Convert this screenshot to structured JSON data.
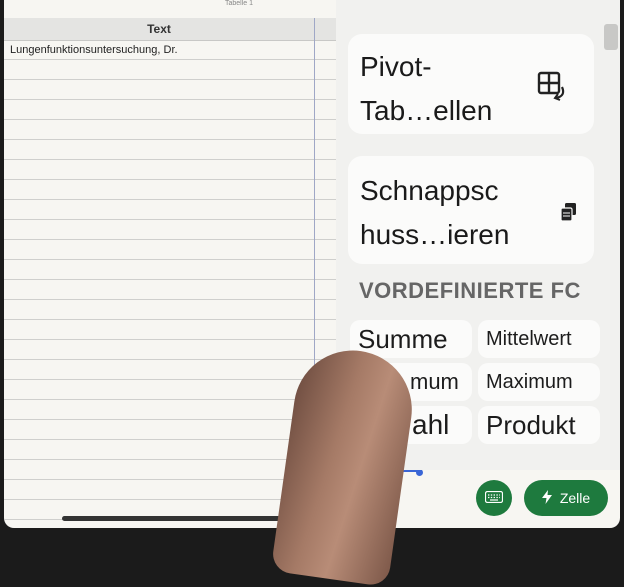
{
  "sheet": {
    "tab_name": "Tabelle 1",
    "column_header": "Text",
    "cell_a1": "Lungenfunktionsuntersuchung, Dr."
  },
  "panel": {
    "pivot_label_line1": "Pivot-",
    "pivot_label_line2": "Tab…ellen",
    "snapshot_label_line1": "Schnappsc",
    "snapshot_label_line2": "huss…ieren",
    "section_title": "VORDEFINIERTE FC",
    "functions": [
      {
        "label": "Summe"
      },
      {
        "label": "Mittelwert"
      },
      {
        "label": "mum"
      },
      {
        "label": "Maximum"
      },
      {
        "label": "ahl"
      },
      {
        "label": "Produkt"
      }
    ]
  },
  "bottom_bar": {
    "cell_button_label": "Zelle"
  },
  "icons": {
    "pivot": "pivot-table-icon",
    "snapshot": "snapshot-icon",
    "keyboard": "keyboard-icon",
    "cell": "lightning-icon"
  },
  "colors": {
    "accent_green": "#1e7a3e",
    "selection_blue": "#3a66d6"
  }
}
